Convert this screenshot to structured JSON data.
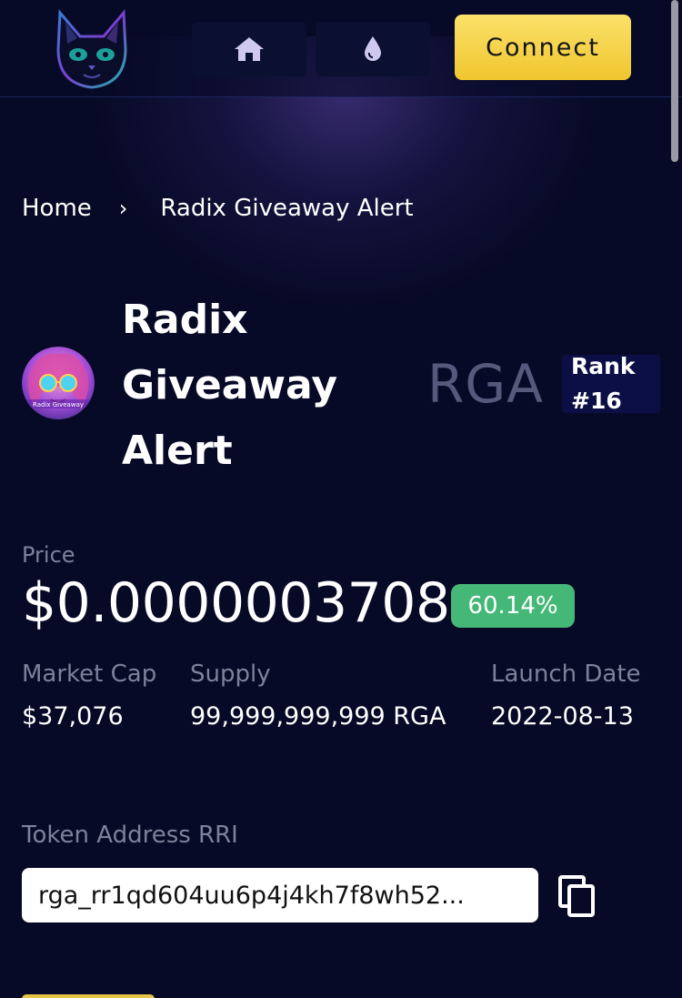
{
  "header": {
    "logo_icon": "cat-logo-icon",
    "nav": [
      {
        "icon": "home-icon"
      },
      {
        "icon": "droplet-icon"
      }
    ],
    "connect_label": "Connect"
  },
  "breadcrumb": {
    "home": "Home",
    "separator": "›",
    "current": "Radix Giveaway Alert"
  },
  "token": {
    "name_lines": [
      "Radix",
      "Giveaway",
      "Alert"
    ],
    "avatar_text": "Radix Giveaway",
    "symbol": "RGA",
    "rank_label": "Rank",
    "rank_value": "#16"
  },
  "price": {
    "label": "Price",
    "value": "$0.0000003708",
    "change": "60.14%",
    "change_color": "#45b878"
  },
  "stats": [
    {
      "label": "Market Cap",
      "value": "$37,076"
    },
    {
      "label": "Supply",
      "value": "99,999,999,999 RGA"
    },
    {
      "label": "Launch Date",
      "value": "2022-08-13"
    }
  ],
  "address": {
    "label": "Token Address RRI",
    "value": "rga_rr1qd604uu6p4j4kh7f8wh52..."
  },
  "colors": {
    "background": "#070a26",
    "accent": "#f4d24a",
    "muted": "#7d8199"
  }
}
